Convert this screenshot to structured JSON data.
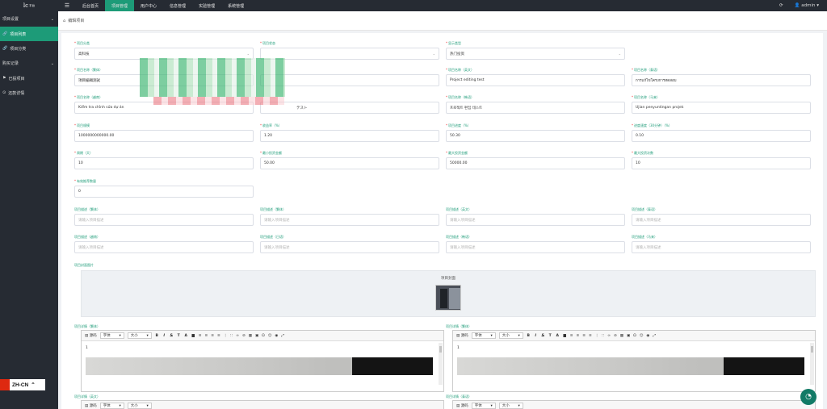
{
  "topbar": {
    "logo": "lc",
    "logo_sup": "平台",
    "nav": [
      "后台首页",
      "项目管理",
      "用户中心",
      "信息管理",
      "实验管理",
      "系统管理"
    ],
    "active_nav": 1,
    "user": "admin"
  },
  "sidebar": {
    "groups": [
      {
        "label": "项目设置",
        "items": [
          {
            "label": "项目列表",
            "icon": "link-icon",
            "active": true
          },
          {
            "label": "项目分类",
            "icon": "link-icon",
            "active": false
          }
        ]
      },
      {
        "label": "购买记录",
        "items": [
          {
            "label": "已投项目",
            "icon": "flag-icon",
            "active": false
          },
          {
            "label": "还款详情",
            "icon": "refund-icon",
            "active": false
          }
        ]
      }
    ],
    "language": "ZH-CN"
  },
  "breadcrumb": {
    "label": "编辑项目"
  },
  "form": {
    "row1": [
      {
        "label": "项目分类",
        "value": "高科技",
        "select": true,
        "required": true
      },
      {
        "label": "项目状态",
        "value": "",
        "select": true,
        "required": true
      },
      {
        "label": "显示类型",
        "value": "热门投资",
        "select": true,
        "required": true
      }
    ],
    "row2": [
      {
        "label": "项目名称（繁体）",
        "value": "項目編輯測試",
        "required": true
      },
      {
        "label": "",
        "value": ""
      },
      {
        "label": "项目名称（英文）",
        "value": "Project editing test",
        "required": true
      },
      {
        "label": "项目名称（泰语）",
        "value": "การแก้ไขโครงการทดสอบ",
        "required": true
      }
    ],
    "row3": [
      {
        "label": "项目名称（越南）",
        "value": "Kiểm tra chỉnh sửa dự án",
        "required": true
      },
      {
        "label": "",
        "value": "テスト"
      },
      {
        "label": "项目名称（韩语）",
        "value": "프로젝트 편집 테스트",
        "required": true
      },
      {
        "label": "项目名称（马来）",
        "value": "Ujian penyuntingan projek",
        "required": true
      }
    ],
    "row4": [
      {
        "label": "项目规模",
        "value": "1000000000000.00",
        "required": true
      },
      {
        "label": "收益率（%）",
        "value": "1.20",
        "required": true
      },
      {
        "label": "项目进度（%）",
        "value": "50.30",
        "required": true
      },
      {
        "label": "进度速度（30分钟）（%）",
        "value": "0.10",
        "required": true
      }
    ],
    "row5": [
      {
        "label": "周期（天）",
        "value": "10",
        "required": true
      },
      {
        "label": "最小投资金额",
        "value": "50.00",
        "required": true
      },
      {
        "label": "最大投资金额",
        "value": "50000.00",
        "required": true
      },
      {
        "label": "最大投资次数",
        "value": "10",
        "required": true
      }
    ],
    "row6": [
      {
        "label": "有效推荐数量",
        "value": "0",
        "required": true
      }
    ],
    "desc_row1": [
      {
        "label": "项目描述（繁体）",
        "placeholder": "请输入项目描述"
      },
      {
        "label": "项目描述（繁体）",
        "placeholder": "请输入项目描述"
      },
      {
        "label": "项目描述（英文）",
        "placeholder": "请输入项目描述"
      },
      {
        "label": "项目描述（泰语）",
        "placeholder": "请输入项目描述"
      }
    ],
    "desc_row2": [
      {
        "label": "项目描述（越南）",
        "placeholder": "请输入项目描述"
      },
      {
        "label": "项目描述（日语）",
        "placeholder": "请输入项目描述"
      },
      {
        "label": "项目描述（韩语）",
        "placeholder": "请输入项目描述"
      },
      {
        "label": "项目描述（马来）",
        "placeholder": "请输入项目描述"
      }
    ],
    "cover_label": "项目封面图片",
    "cover_title": "项目封面",
    "editors": [
      {
        "label": "项目详情（繁体）",
        "body": "1"
      },
      {
        "label": "项目详情（繁体）",
        "body": "1"
      },
      {
        "label": "项目详情（英文）",
        "body": ""
      },
      {
        "label": "项目详情（泰语）",
        "body": ""
      }
    ],
    "toolbar": {
      "source": "源码",
      "font": "字体",
      "size": "大小"
    }
  }
}
